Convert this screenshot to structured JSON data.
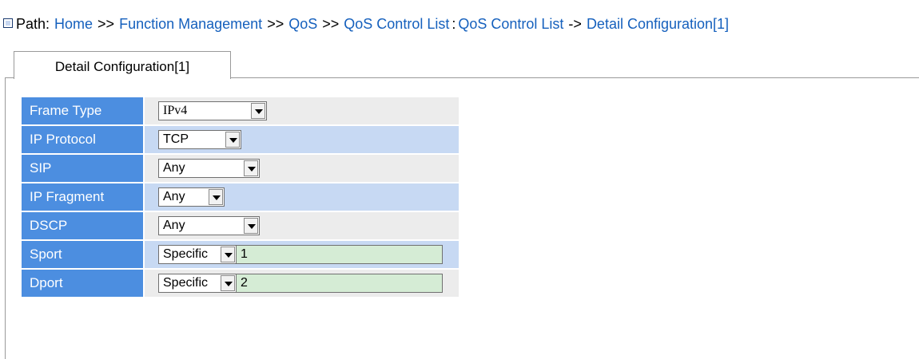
{
  "path": {
    "label": "Path:",
    "crumbs": [
      "Home",
      "Function Management",
      "QoS",
      "QoS Control List",
      "QoS Control List",
      "Detail Configuration[1]"
    ],
    "separators": [
      ">>",
      ">>",
      ">>",
      ":",
      "->"
    ]
  },
  "tab": {
    "label": "Detail Configuration[1]"
  },
  "form": {
    "rows": [
      {
        "label": "Frame Type",
        "value": "IPv4"
      },
      {
        "label": "IP Protocol",
        "value": "TCP"
      },
      {
        "label": "SIP",
        "value": "Any"
      },
      {
        "label": "IP Fragment",
        "value": "Any"
      },
      {
        "label": "DSCP",
        "value": "Any"
      },
      {
        "label": "Sport",
        "value": "Specific",
        "text": "1"
      },
      {
        "label": "Dport",
        "value": "Specific",
        "text": "2"
      }
    ]
  },
  "colors": {
    "label_bg": "#4c8ee0",
    "row_gray": "#ececec",
    "row_blue": "#c7d9f3",
    "link": "#1560bd",
    "input_green": "#d5ecd5"
  },
  "icons": {
    "path_marker": "square-marker-icon",
    "dropdown": "chevron-down-icon"
  }
}
